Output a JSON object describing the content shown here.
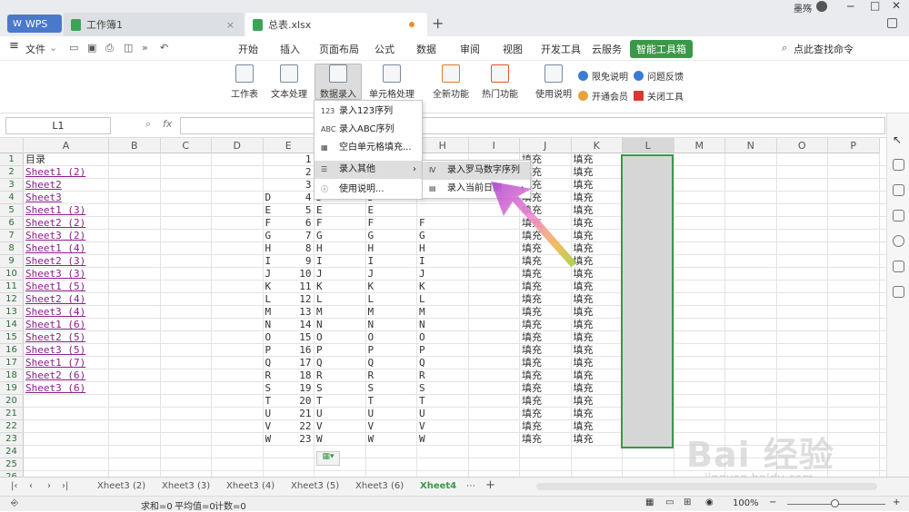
{
  "titlebar": {
    "app_tab": "WPS",
    "tabs": [
      {
        "label": "工作簿1"
      },
      {
        "label": "总表.xlsx"
      }
    ],
    "user": "墨殇",
    "window_controls": [
      "minimize-icon",
      "maximize-icon",
      "close-icon"
    ]
  },
  "menubar": {
    "file": "文件",
    "items": [
      "开始",
      "插入",
      "页面布局",
      "公式",
      "数据",
      "审阅",
      "视图",
      "开发工具",
      "云服务",
      "智能工具箱"
    ],
    "search": "点此查找命令"
  },
  "ribbon": {
    "buttons": [
      "工作表",
      "文本处理",
      "数据录入",
      "单元格处理",
      "全新功能",
      "热门功能",
      "使用说明"
    ],
    "side": [
      "限免说明",
      "问题反馈",
      "开通会员",
      "关闭工具"
    ]
  },
  "formula": {
    "namebox": "L1",
    "fx": "fx"
  },
  "columns": [
    "A",
    "B",
    "C",
    "D",
    "E",
    "F",
    "G",
    "H",
    "I",
    "J",
    "K",
    "L",
    "M",
    "N",
    "O",
    "P"
  ],
  "rows": [
    "1",
    "2",
    "3",
    "4",
    "5",
    "6",
    "7",
    "8",
    "9",
    "10",
    "11",
    "12",
    "13",
    "14",
    "15",
    "16",
    "17",
    "18",
    "19",
    "20",
    "21",
    "22",
    "23",
    "24",
    "25",
    "26"
  ],
  "col_a": [
    "目录",
    "Sheet1 (2)",
    "Sheet2",
    "Sheet3",
    "Sheet1 (3)",
    "Sheet2 (2)",
    "Sheet3 (2)",
    "Sheet1 (4)",
    "Sheet2 (3)",
    "Sheet3 (3)",
    "Sheet1 (5)",
    "Sheet2 (4)",
    "Sheet3 (4)",
    "Sheet1 (6)",
    "Sheet2 (5)",
    "Sheet3 (5)",
    "Sheet1 (7)",
    "Sheet2 (6)",
    "Sheet3 (6)"
  ],
  "col_e": [
    "1",
    "2",
    "3",
    "4",
    "5",
    "6",
    "7",
    "8",
    "9",
    "10",
    "11",
    "12",
    "13",
    "14",
    "15",
    "16",
    "17",
    "18",
    "19",
    "20",
    "21",
    "22",
    "23"
  ],
  "letters": [
    "",
    "",
    "",
    "D",
    "E",
    "F",
    "G",
    "H",
    "I",
    "J",
    "K",
    "L",
    "M",
    "N",
    "O",
    "P",
    "Q",
    "R",
    "S",
    "T",
    "U",
    "V",
    "W"
  ],
  "fill": "填充",
  "menu1": [
    "录入123序列",
    "录入ABC序列",
    "空白单元格填充...",
    "录入其他",
    "使用说明..."
  ],
  "menu2": [
    "录入罗马数字序列",
    "录入当前日期"
  ],
  "sheets": [
    "Xheet3 (2)",
    "Xheet3 (3)",
    "Xheet3 (4)",
    "Xheet3 (5)",
    "Xheet3 (6)",
    "Xheet4"
  ],
  "status": {
    "sum": "求和=0",
    "avg": "平均值=0",
    "count": "计数=0",
    "zoom": "100%"
  },
  "watermark": {
    "brand": "Bai 经验",
    "url": "jingyan.baidu.com"
  }
}
